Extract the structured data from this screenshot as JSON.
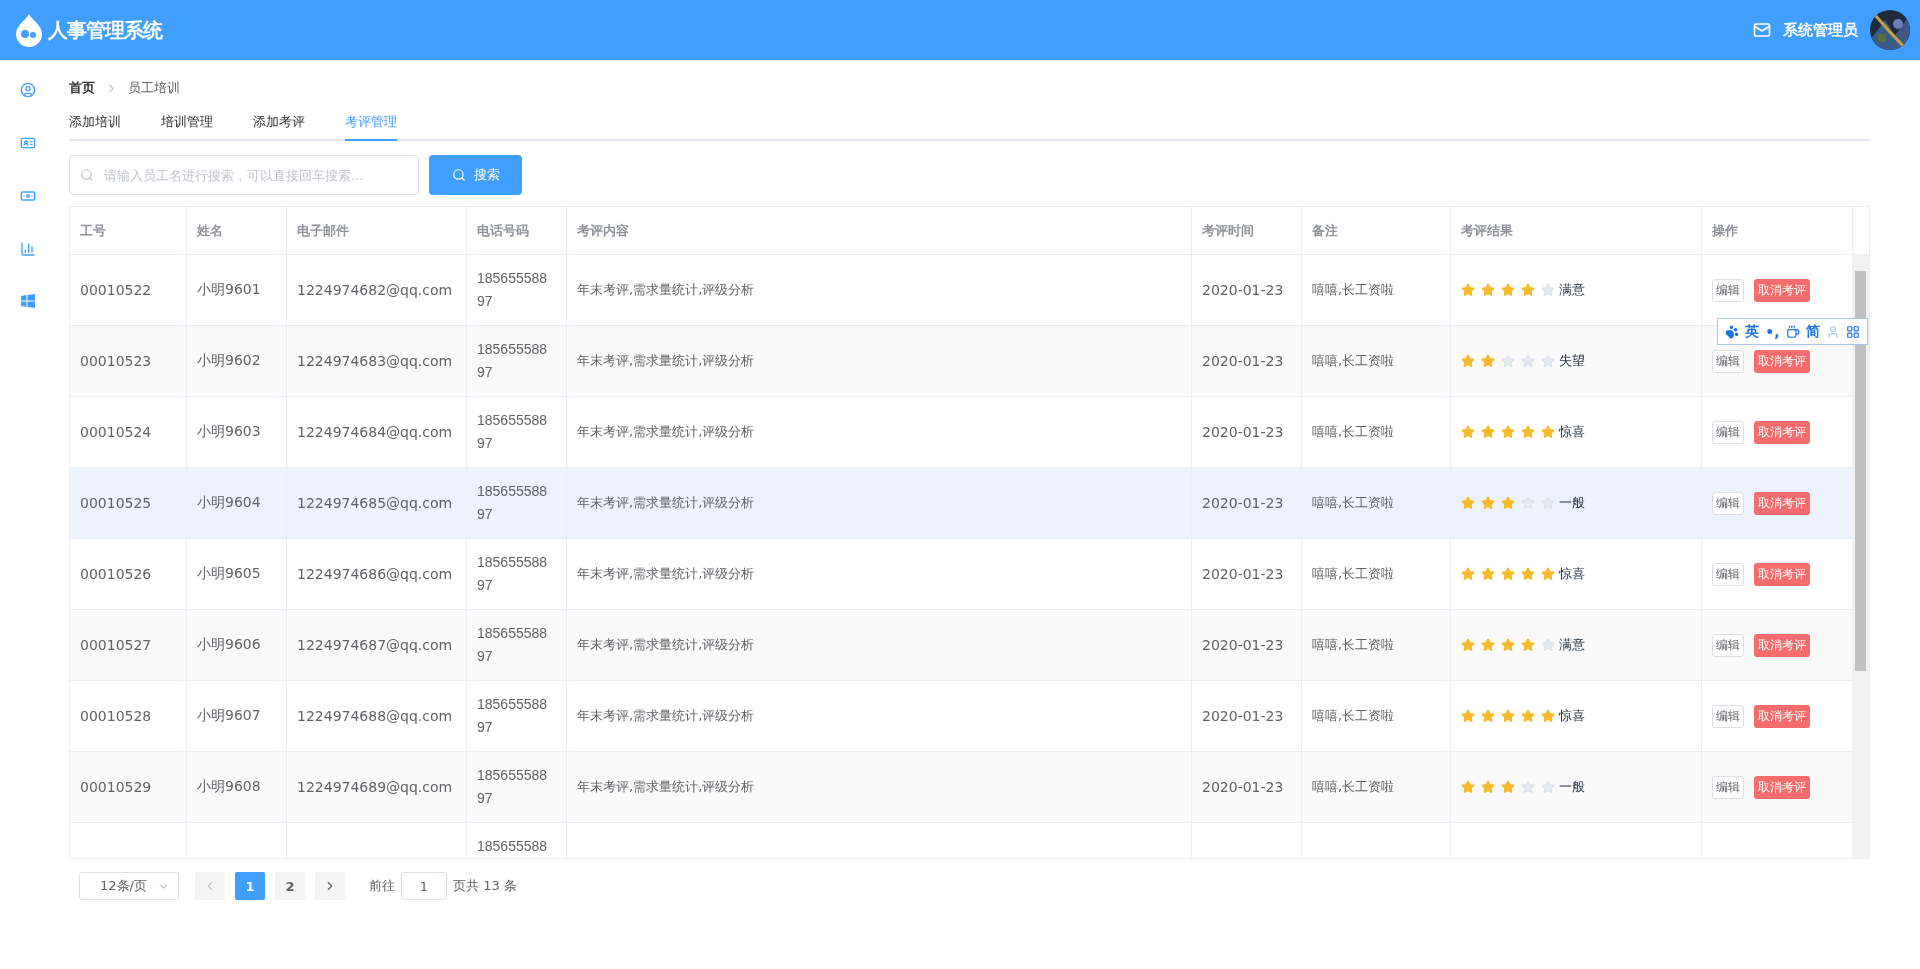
{
  "header": {
    "title": "人事管理系统",
    "user": "系统管理员"
  },
  "breadcrumb": [
    "首页",
    "员工培训"
  ],
  "tabs": [
    {
      "label": "添加培训",
      "selected": false
    },
    {
      "label": "培训管理",
      "selected": false
    },
    {
      "label": "添加考评",
      "selected": false
    },
    {
      "label": "考评管理",
      "selected": true
    }
  ],
  "search": {
    "placeholder": "请输入员工名进行搜索，可以直接回车搜索...",
    "button": "搜索"
  },
  "table": {
    "columns": [
      "工号",
      "姓名",
      "电子邮件",
      "电话号码",
      "考评内容",
      "考评时间",
      "备注",
      "考评结果",
      "操作"
    ],
    "rows": [
      {
        "id": "00010522",
        "name": "小明9601",
        "email": "1224974682@qq.com",
        "phone": "18565558897",
        "content": "年末考评,需求量统计,评级分析",
        "date": "2020-01-23",
        "remark": "嘻嘻,长工资啦",
        "stars": 4,
        "result": "满意",
        "hovered": false,
        "actions": [
          "编辑",
          "取消考评"
        ]
      },
      {
        "id": "00010523",
        "name": "小明9602",
        "email": "1224974683@qq.com",
        "phone": "18565558897",
        "content": "年末考评,需求量统计,评级分析",
        "date": "2020-01-23",
        "remark": "嘻嘻,长工资啦",
        "stars": 2,
        "result": "失望",
        "hovered": false,
        "actions": [
          "编辑",
          "取消考评"
        ]
      },
      {
        "id": "00010524",
        "name": "小明9603",
        "email": "1224974684@qq.com",
        "phone": "18565558897",
        "content": "年末考评,需求量统计,评级分析",
        "date": "2020-01-23",
        "remark": "嘻嘻,长工资啦",
        "stars": 5,
        "result": "惊喜",
        "hovered": false,
        "actions": [
          "编辑",
          "取消考评"
        ]
      },
      {
        "id": "00010525",
        "name": "小明9604",
        "email": "1224974685@qq.com",
        "phone": "18565558897",
        "content": "年末考评,需求量统计,评级分析",
        "date": "2020-01-23",
        "remark": "嘻嘻,长工资啦",
        "stars": 3,
        "result": "一般",
        "hovered": true,
        "actions": [
          "编辑",
          "取消考评"
        ]
      },
      {
        "id": "00010526",
        "name": "小明9605",
        "email": "1224974686@qq.com",
        "phone": "18565558897",
        "content": "年末考评,需求量统计,评级分析",
        "date": "2020-01-23",
        "remark": "嘻嘻,长工资啦",
        "stars": 5,
        "result": "惊喜",
        "hovered": false,
        "actions": [
          "编辑",
          "取消考评"
        ]
      },
      {
        "id": "00010527",
        "name": "小明9606",
        "email": "1224974687@qq.com",
        "phone": "18565558897",
        "content": "年末考评,需求量统计,评级分析",
        "date": "2020-01-23",
        "remark": "嘻嘻,长工资啦",
        "stars": 4,
        "result": "满意",
        "hovered": false,
        "actions": [
          "编辑",
          "取消考评"
        ]
      },
      {
        "id": "00010528",
        "name": "小明9607",
        "email": "1224974688@qq.com",
        "phone": "18565558897",
        "content": "年末考评,需求量统计,评级分析",
        "date": "2020-01-23",
        "remark": "嘻嘻,长工资啦",
        "stars": 5,
        "result": "惊喜",
        "hovered": false,
        "actions": [
          "编辑",
          "取消考评"
        ]
      },
      {
        "id": "00010529",
        "name": "小明9608",
        "email": "1224974689@qq.com",
        "phone": "18565558897",
        "content": "年末考评,需求量统计,评级分析",
        "date": "2020-01-23",
        "remark": "嘻嘻,长工资啦",
        "stars": 3,
        "result": "一般",
        "hovered": false,
        "actions": [
          "编辑",
          "取消考评"
        ]
      },
      {
        "phone": "185655588",
        "hovered": false
      }
    ]
  },
  "pagination": {
    "page_size": "12条/页",
    "pages": [
      {
        "label": "1",
        "selected": true
      },
      {
        "label": "2",
        "selected": false
      }
    ],
    "prev_disabled": true,
    "goto_label": "前往",
    "goto_value": "1",
    "total": "页共 13 条"
  },
  "ime_toolbar": {
    "items": [
      "英",
      "•,",
      "简"
    ]
  }
}
